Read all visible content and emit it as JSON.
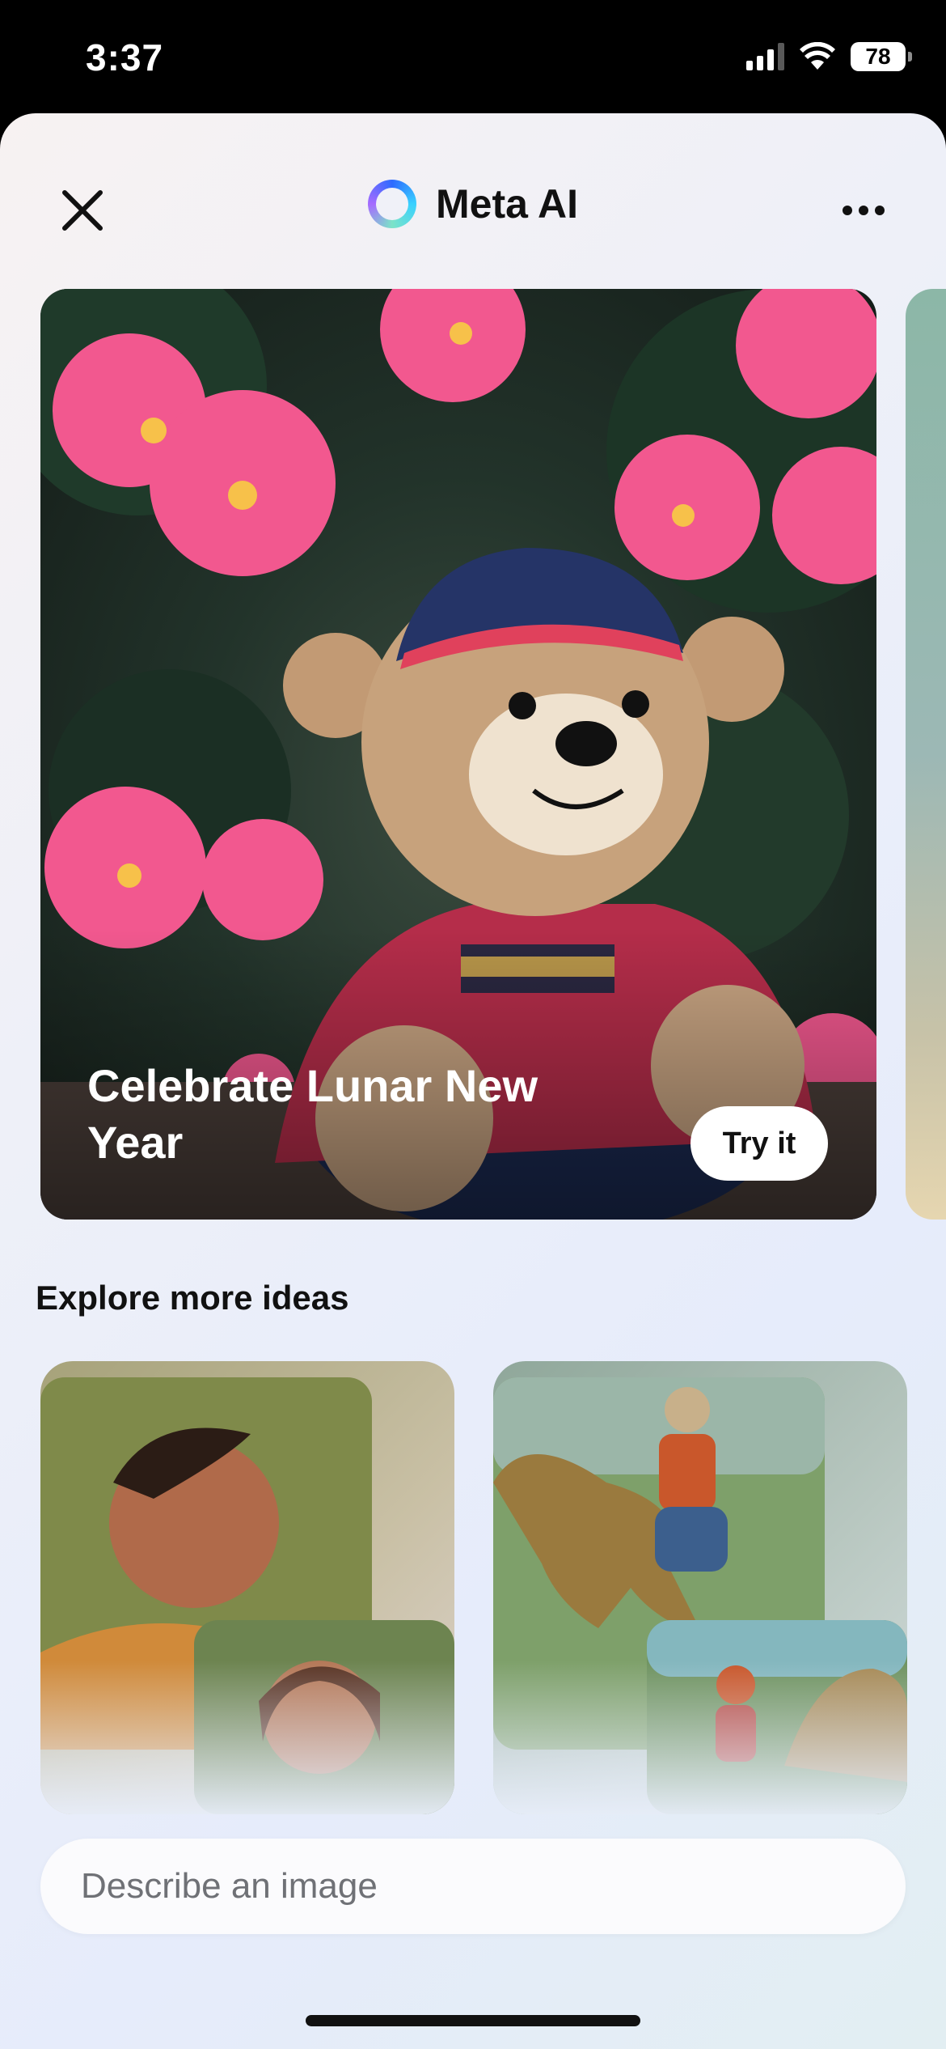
{
  "status_bar": {
    "time": "3:37",
    "battery": "78",
    "icons": [
      "signal-icon",
      "wifi-icon",
      "battery-icon"
    ]
  },
  "header": {
    "title": "Meta AI",
    "icons": [
      "close-icon",
      "meta-ai-logo-icon",
      "more-options-icon"
    ]
  },
  "hero": {
    "title": "Celebrate Lunar New Year",
    "button_label": "Try it",
    "image_subject": "teddy bear in hanbok with pink hibiscus flowers"
  },
  "explore": {
    "title": "Explore more ideas",
    "cards": [
      {
        "image_subject": "impressionist portrait of a man and a woman"
      },
      {
        "image_subject": "person riding a dinosaur"
      }
    ]
  },
  "search": {
    "placeholder": "Describe an image",
    "value": ""
  },
  "colors": {
    "accent": "#2e6bff",
    "text": "#111111",
    "placeholder": "#6f7176"
  }
}
